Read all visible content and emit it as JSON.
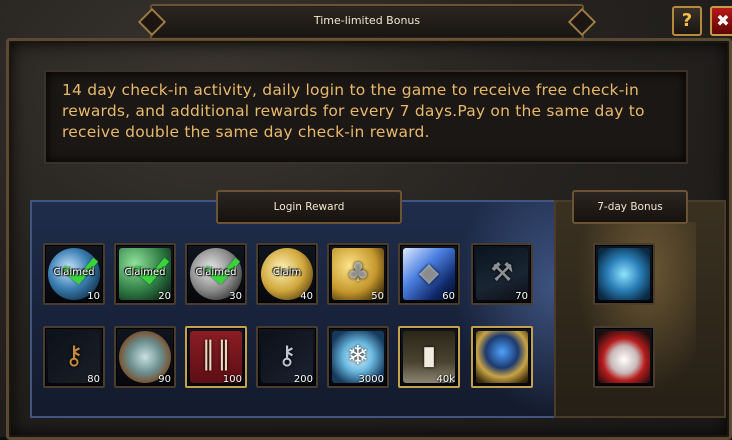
{
  "window": {
    "title": "Time-limited Bonus",
    "help_label": "?",
    "close_label": "✖"
  },
  "description": "14 day check-in activity, daily login to the game to receive free check-in rewards, and additional rewards for every 7 days.Pay on the same day to receive double the same day check-in reward.",
  "login_reward": {
    "label": "Login Reward",
    "items": [
      {
        "icon": "blue-coin-icon",
        "qty": "10",
        "status": "Claimed"
      },
      {
        "icon": "green-key-icon",
        "qty": "20",
        "status": "Claimed"
      },
      {
        "icon": "silver-coin-icon",
        "qty": "30",
        "status": "Claimed"
      },
      {
        "icon": "gold-coin-icon",
        "qty": "40",
        "status": "Claim"
      },
      {
        "icon": "gold-clover-icon",
        "qty": "50",
        "status": ""
      },
      {
        "icon": "blue-crystal-icon",
        "qty": "60",
        "status": ""
      },
      {
        "icon": "pickaxe-icon",
        "qty": "70",
        "status": ""
      },
      {
        "icon": "bronze-key-icon",
        "qty": "80",
        "status": ""
      },
      {
        "icon": "shield-icon",
        "qty": "90",
        "status": ""
      },
      {
        "icon": "bones-icon",
        "qty": "100",
        "status": ""
      },
      {
        "icon": "key-ring-icon",
        "qty": "200",
        "status": ""
      },
      {
        "icon": "snowflake-icon",
        "qty": "3000",
        "status": ""
      },
      {
        "icon": "vial-icon",
        "qty": "40k",
        "status": ""
      },
      {
        "icon": "ring-icon",
        "qty": "",
        "status": ""
      }
    ]
  },
  "seven_day_bonus": {
    "label": "7-day Bonus",
    "items": [
      {
        "icon": "moose-icon"
      },
      {
        "icon": "viking-helmet-icon"
      }
    ]
  }
}
